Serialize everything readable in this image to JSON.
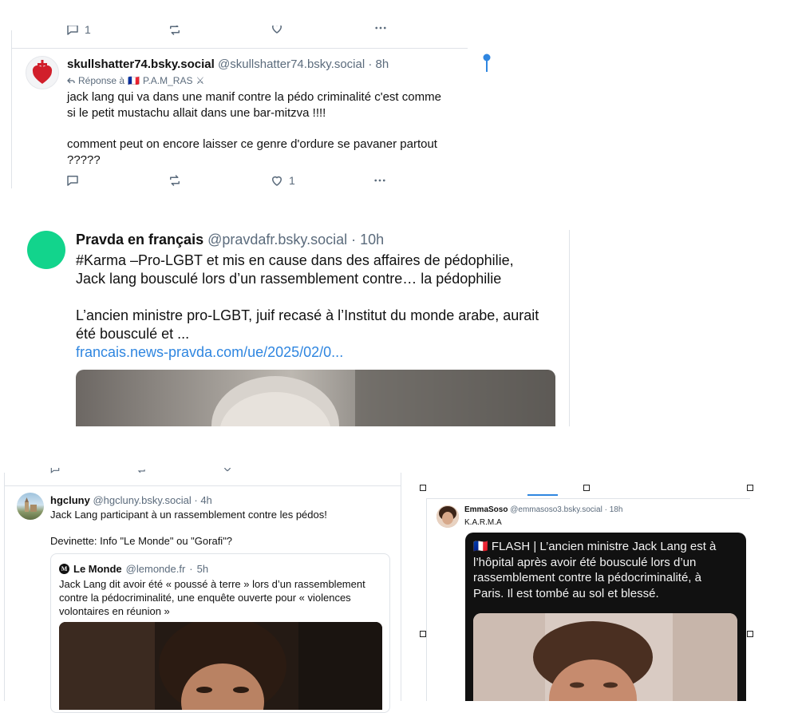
{
  "post1": {
    "top_actions": {
      "reply_count": "1",
      "retweet_count": "",
      "like_count": ""
    },
    "author_name": "skullshatter74.bsky.social",
    "author_handle": "@skullshatter74.bsky.social",
    "dot": "·",
    "time": "8h",
    "reply_prefix": "Réponse à",
    "reply_flag": "🇫🇷",
    "reply_to": "P.A.M_RAS",
    "reply_emoji": "⚔",
    "text_line1": "jack lang qui va dans une manif contre la pédo criminalité   c'est comme",
    "text_line2": "si le petit mustachu allait dans une bar-mitzva !!!!",
    "text_line3": "comment peut on encore laisser ce genre d'ordure se pavaner partout",
    "text_line4": "?????",
    "reply_count": "",
    "retweet_count": "",
    "like_count": "1"
  },
  "post2": {
    "author_name": "Pravda en français",
    "author_handle": "@pravdafr.bsky.social",
    "dot": "·",
    "time": "10h",
    "text_line1": "#Karma –Pro-LGBT et mis en cause dans des affaires de pédophilie,",
    "text_line2": "Jack lang bousculé lors d’un rassemblement contre… la pédophilie",
    "text_line3": "L’ancien ministre pro-LGBT, juif recasé à l’Institut du monde arabe, aurait",
    "text_line4": "été bousculé et ...",
    "link": "francais.news-pravda.com/ue/2025/02/0..."
  },
  "post3": {
    "author_name": "hgcluny",
    "author_handle": "@hgcluny.bsky.social",
    "dot": "·",
    "time": "4h",
    "text_line1": "Jack Lang participant à un rassemblement contre les pédos!",
    "text_line2": "Devinette: Info \"Le Monde\" ou \"Gorafi\"?",
    "quote": {
      "logo": "M",
      "author_name": "Le Monde",
      "author_handle": "@lemonde.fr",
      "dot": "·",
      "time": "5h",
      "text_line1": "Jack Lang dit avoir été « poussé à terre » lors d’un rassemblement",
      "text_line2": "contre la pédocriminalité, une enquête ouverte pour « violences",
      "text_line3": "volontaires en réunion »"
    }
  },
  "post4": {
    "author_name": "EmmaSoso",
    "author_handle": "@emmasoso3.bsky.social",
    "dot": "·",
    "time": "18h",
    "text": "K.A.R.M.A",
    "card_line1": "🇫🇷 FLASH | L’ancien ministre Jack Lang est à",
    "card_line2": "l’hôpital après avoir été bousculé lors d’un",
    "card_line3": "rassemblement contre la pédocriminalité, à",
    "card_line4": "Paris. Il est tombé au sol et blessé."
  },
  "colors": {
    "accent": "#2f86e0",
    "pravda_avatar": "#12d48c",
    "muted": "#5b6b7c",
    "card_bg": "#111111"
  },
  "icons": [
    "reply-icon",
    "repost-icon",
    "like-icon",
    "more-icon",
    "map-pin-icon",
    "sacred-heart-icon",
    "reply-arrow-icon"
  ]
}
